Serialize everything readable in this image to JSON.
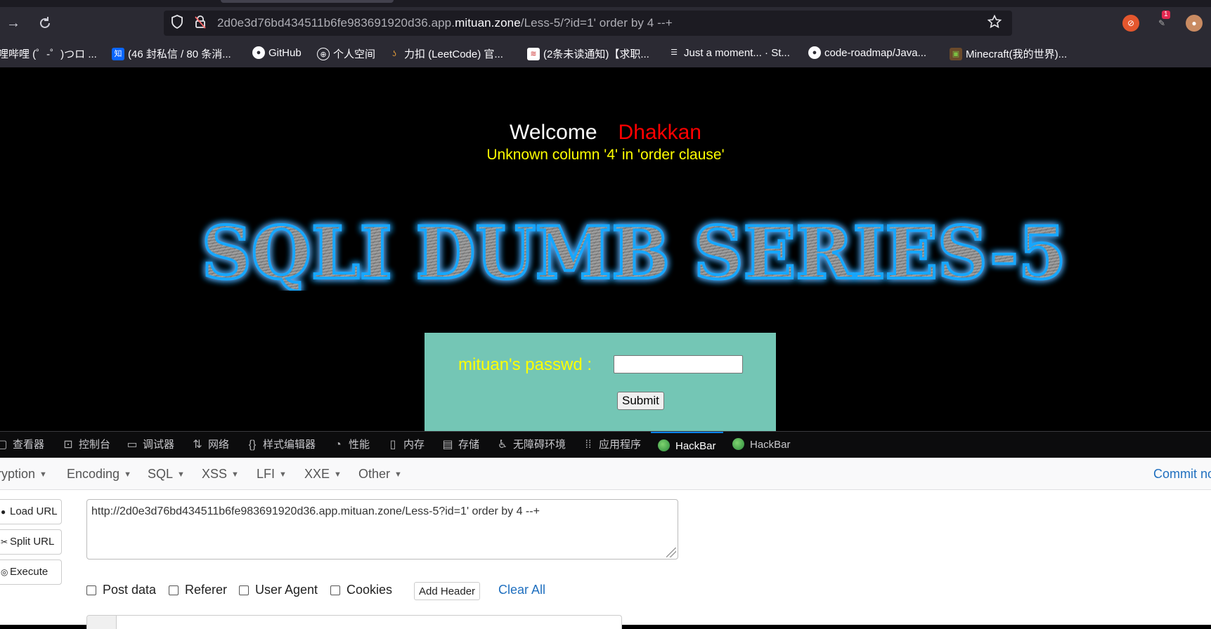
{
  "browser": {
    "url_prefix": "2d0e3d76bd434511b6fe983691920d36.app.",
    "url_domain": "mituan.zone",
    "url_suffix": "/Less-5/?id=1' order by 4 --+",
    "ext_badge": "1",
    "bookmarks": [
      {
        "label": "哩哔哩 (゜-゜)つロ ...",
        "icon": "bilibili-icon"
      },
      {
        "label": "(46 封私信 / 80 条消...",
        "icon": "zhihu-icon",
        "glyph": "知"
      },
      {
        "label": "GitHub",
        "icon": "github-icon"
      },
      {
        "label": "个人空间",
        "icon": "globe-icon"
      },
      {
        "label": "力扣 (LeetCode) 官...",
        "icon": "leetcode-icon"
      },
      {
        "label": "(2条未读通知)【求职...",
        "icon": "nowcoder-icon"
      },
      {
        "label": "Just a moment... · St...",
        "icon": "stack-icon"
      },
      {
        "label": "code-roadmap/Java...",
        "icon": "github-icon"
      },
      {
        "label": "Minecraft(我的世界)...",
        "icon": "minecraft-icon"
      }
    ]
  },
  "page": {
    "welcome": "Welcome",
    "name": "Dhakkan",
    "error": "Unknown column '4' in 'order clause'",
    "banner": "SQLI DUMB SERIES-5",
    "passwd_label": "mituan's passwd :",
    "submit_label": "Submit"
  },
  "devtools": {
    "tabs": [
      {
        "label": "查看器",
        "icon": "inspector-icon"
      },
      {
        "label": "控制台",
        "icon": "console-icon"
      },
      {
        "label": "调试器",
        "icon": "debugger-icon"
      },
      {
        "label": "网络",
        "icon": "network-icon"
      },
      {
        "label": "样式编辑器",
        "icon": "braces-icon"
      },
      {
        "label": "性能",
        "icon": "gauge-icon"
      },
      {
        "label": "内存",
        "icon": "memory-icon"
      },
      {
        "label": "存储",
        "icon": "storage-icon"
      },
      {
        "label": "无障碍环境",
        "icon": "accessibility-icon"
      },
      {
        "label": "应用程序",
        "icon": "grid-icon"
      },
      {
        "label": "HackBar",
        "icon": "hackbar-icon"
      },
      {
        "label": "HackBar",
        "icon": "hackbar-icon"
      }
    ],
    "active_tab": 10
  },
  "hackbar": {
    "menu": [
      "ryption",
      "Encoding",
      "SQL",
      "XSS",
      "LFI",
      "XXE",
      "Other"
    ],
    "commit_link": "Commit no",
    "buttons": {
      "load": "Load URL",
      "split": "Split URL",
      "execute": "Execute"
    },
    "url_value": "http://2d0e3d76bd434511b6fe983691920d36.app.mituan.zone/Less-5?id=1' order by 4 --+",
    "checks": {
      "post": "Post data",
      "referer": "Referer",
      "ua": "User Agent",
      "cookies": "Cookies"
    },
    "add_header": "Add Header",
    "clear_all": "Clear All"
  },
  "colors": {
    "welcome_name": "#ff0000",
    "error_text": "#ffff00",
    "login_bg": "#74c6b5",
    "banner_glow": "#19a7ff",
    "active_tab_accent": "#0a84ff",
    "link_blue": "#1f6fbf"
  }
}
